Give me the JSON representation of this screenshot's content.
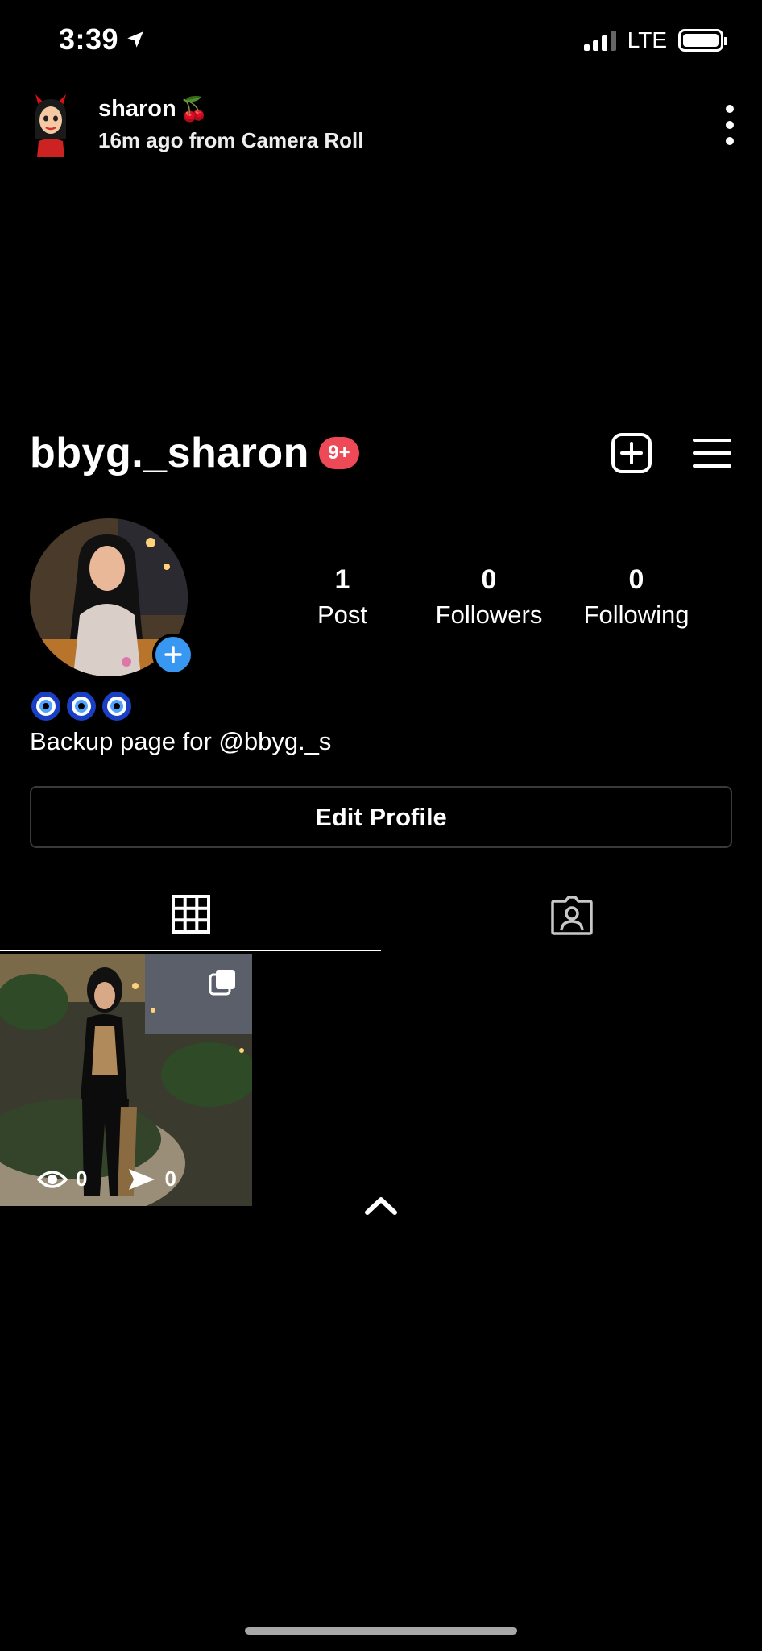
{
  "status_bar": {
    "time": "3:39",
    "network": "LTE"
  },
  "story_header": {
    "name": "sharon",
    "name_emoji": "🍒",
    "subtitle": "16m ago from Camera Roll"
  },
  "profile": {
    "username": "bbyg._sharon",
    "notification_badge": "9+",
    "bio_emojis": "🧿🧿🧿",
    "bio": "Backup page for @bbyg._s",
    "edit_profile_label": "Edit Profile"
  },
  "stats": [
    {
      "value": "1",
      "label": "Post"
    },
    {
      "value": "0",
      "label": "Followers"
    },
    {
      "value": "0",
      "label": "Following"
    }
  ],
  "post": {
    "views": "0",
    "shares": "0"
  },
  "icons": {
    "location": "location-arrow-icon",
    "more": "more-vertical-icon",
    "new_post": "plus-square-icon",
    "menu": "hamburger-menu-icon",
    "grid": "grid-icon",
    "tagged": "tagged-person-icon",
    "views": "eye-icon",
    "shares": "send-icon",
    "multi": "carousel-icon",
    "collapse": "chevron-up-icon"
  },
  "colors": {
    "background": "#000000",
    "badge": "#ed4956",
    "accent_blue": "#3897f0"
  }
}
